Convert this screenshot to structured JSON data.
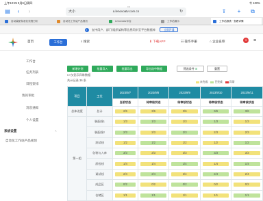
{
  "status": {
    "left": "上午10:25 9月6日周四",
    "right": "令 100%"
  },
  "browser": {
    "dots": "•••",
    "url": "a.lenovoatv.com.cn",
    "aa": "大小",
    "tabs": [
      {
        "label": "自动装配标准化流程分析",
        "color": "#2b6fd8"
      },
      {
        "label": "自动化工作站产品规划",
        "color": "#e08a2b"
      },
      {
        "label": "Lenovoatv平台",
        "color": "#2faa5b"
      },
      {
        "label": "工作站展示",
        "color": "#999999"
      },
      {
        "label": "工作站报表 · 查看详情",
        "color": "#2b6fd8"
      }
    ],
    "notice_text": "支持用户、部门/组织架构等信息同步至平台数据库",
    "notice_button": "立即开通"
  },
  "appbar": {
    "home": "首页",
    "active_btn": "工作台",
    "search": "搜索",
    "download": "下载APP",
    "manual": "操作手册",
    "org": "企业名称",
    "badge": "3"
  },
  "sidebar": {
    "items": [
      "工作台",
      "任务列表",
      "日程安排",
      "我的审批",
      "消息通知",
      "个人设置"
    ],
    "section": "系统设置",
    "sub": "自动化工作站产品规划"
  },
  "toolbar": {
    "buttons": [
      "新增计划",
      "批量导入",
      "批量导出",
      "导出选中数据"
    ],
    "filter_label": "筛选条件",
    "reset_label": "重置"
  },
  "options": {
    "checkbox": "仅显示异常数据",
    "summary": "共计记录 36 条"
  },
  "legend": [
    {
      "label": "未完成",
      "color": "#f2e27a"
    },
    {
      "label": "已完成",
      "color": "#bfe39b"
    },
    {
      "label": "异常",
      "color": "#e23b3b"
    }
  ],
  "table": {
    "group_header": "项目",
    "item_header": "工位",
    "col_dates": [
      "2023/9/7",
      "2023/9/8",
      "2023/9/9",
      "2023/9/10",
      "2023/9/11"
    ],
    "col_status": [
      "当前状态",
      "待审核状态",
      "待审核状态",
      "待审核状态",
      "待审核状态"
    ],
    "top_row": {
      "group": "总体进度",
      "item": "总计",
      "values": [
        "2/6",
        "3/6",
        "3/6",
        "3/6",
        "3/6"
      ]
    },
    "group_name": "第一组",
    "rows": [
      {
        "item": "装配线1",
        "values": [
          "1/3",
          "1/3",
          "1/3",
          "1/3",
          "1/3"
        ]
      },
      {
        "item": "装配线2",
        "values": [
          "2/3",
          "2/3",
          "2/3",
          "2/3",
          "2/3"
        ]
      },
      {
        "item": "测试线",
        "values": [
          "1/2",
          "1/2",
          "1/2",
          "1/2",
          "1/2"
        ]
      },
      {
        "item": "包装与入库",
        "values": [
          "3/3",
          "3/3",
          "3/3",
          "3/3",
          "3/3"
        ]
      },
      {
        "item": "质检线",
        "values": [
          "1/4",
          "1/4",
          "1/4",
          "1/4",
          "1/4"
        ]
      },
      {
        "item": "调试线",
        "values": [
          "2/4",
          "2/4",
          "2/4",
          "2/4",
          "2/4"
        ]
      },
      {
        "item": "成品区",
        "values": [
          "0/2",
          "0/2",
          "0/2",
          "0/2",
          "0/2"
        ]
      },
      {
        "item": "仓储区",
        "values": [
          "1/1",
          "1/1",
          "1/1",
          "1/1",
          "1/1"
        ]
      }
    ]
  }
}
